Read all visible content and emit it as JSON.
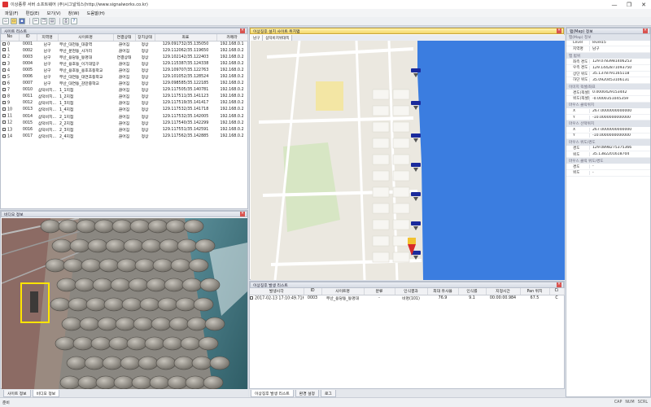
{
  "window": {
    "title": "이상종류 서버 소프트웨어 (주)시그널웍스(http://www.signalworks.co.kr)",
    "controls": [
      "—",
      "❐",
      "✕"
    ]
  },
  "menu": [
    "파일(F)",
    "편집(E)",
    "보기(V)",
    "창(W)",
    "도움말(H)"
  ],
  "toolbar_icons": [
    "new-file-icon",
    "open-folder-icon",
    "save-icon",
    "cut-icon",
    "copy-icon",
    "paste-icon",
    "print-icon",
    "help-icon"
  ],
  "site_list": {
    "title": "사이트 리스트",
    "columns": [
      "No",
      "ID",
      "지역명",
      "사이트명",
      "연결상태",
      "장치상태",
      "좌표",
      "카메라"
    ],
    "rows": [
      [
        "0",
        "0001",
        "남구",
        "부산_대천동_대광역",
        "끊어짐",
        "정상",
        "129.091732/35.135050",
        "192.168.0.1"
      ],
      [
        "1",
        "0002",
        "남구",
        "부산_문현동_사거리",
        "끊어짐",
        "정상",
        "129.112062/35.119650",
        "192.168.0.2"
      ],
      [
        "2",
        "0003",
        "남구",
        "부산_용당동_동명대",
        "연결상태",
        "정상",
        "129.102142/35.122403",
        "192.168.0.2"
      ],
      [
        "3",
        "0004",
        "남구",
        "부산_용호동_이기대입구",
        "끊어짐",
        "정상",
        "129.115387/35.124338",
        "192.168.0.2"
      ],
      [
        "4",
        "0005",
        "남구",
        "부산_용호동_용호초등학교",
        "끊어짐",
        "정상",
        "129.109707/35.122763",
        "192.168.0.2"
      ],
      [
        "5",
        "0006",
        "남구",
        "부산_대연동_대연초등학교",
        "끊어짐",
        "정상",
        "129.101052/35.128524",
        "192.168.0.2"
      ],
      [
        "6",
        "0007",
        "남구",
        "부산_대연동_감만중학교",
        "끊어짐",
        "정상",
        "129.098585/35.122185",
        "192.168.0.2"
      ],
      [
        "7",
        "0010",
        "삼덕비치...",
        "1_1지점",
        "끊어짐",
        "정상",
        "129.117505/35.140781",
        "192.168.0.2"
      ],
      [
        "8",
        "0011",
        "삼덕비치...",
        "1_2지점",
        "끊어짐",
        "정상",
        "129.117511/35.141123",
        "192.168.0.2"
      ],
      [
        "9",
        "0012",
        "삼덕비치...",
        "1_3지점",
        "끊어짐",
        "정상",
        "129.117519/35.141417",
        "192.168.0.2"
      ],
      [
        "10",
        "0013",
        "삼덕비치...",
        "1_4지점",
        "끊어짐",
        "정상",
        "129.117532/35.141718",
        "192.168.0.2"
      ],
      [
        "11",
        "0014",
        "삼덕비치...",
        "2_1지점",
        "끊어짐",
        "정상",
        "129.117532/35.142005",
        "192.168.0.2"
      ],
      [
        "12",
        "0015",
        "삼덕비치...",
        "2_2지점",
        "끊어짐",
        "정상",
        "129.117540/35.142299",
        "192.168.0.2"
      ],
      [
        "13",
        "0016",
        "삼덕비치...",
        "2_3지점",
        "끊어짐",
        "정상",
        "129.117551/35.142591",
        "192.168.0.2"
      ],
      [
        "14",
        "0017",
        "삼덕비치...",
        "2_4지점",
        "끊어짐",
        "정상",
        "129.117562/35.142885",
        "192.168.0.2"
      ]
    ]
  },
  "video_panel": {
    "title": "비디오 정보"
  },
  "left_tabs": [
    "사이트 정보",
    "비디오 정보"
  ],
  "map_panel": {
    "title": "이상징후 설치 사이트 위치맵",
    "tabs": [
      "남구",
      "삼덕비치위대쪽"
    ]
  },
  "info_panel": {
    "title": "맵(Map) 정보",
    "groups": [
      {
        "name": "맵(Map) 정보",
        "rows": [
          [
            "Level",
            "level15"
          ],
          [
            "지역명",
            "남구"
          ]
        ]
      },
      {
        "name": "맵 범위",
        "rows": [
          [
            "좌측 경도",
            "129.0783981406253"
          ],
          [
            "우측 경도",
            "129.1442871093750"
          ],
          [
            "상단 위도",
            "35.1378791165118"
          ],
          [
            "하단 위도",
            "35.0920453106131"
          ]
        ]
      },
      {
        "name": "이미지 픽셀/좌표",
        "rows": [
          [
            "경도(픽셀당)",
            "0.0000429153442"
          ],
          [
            "위도(픽셀당)",
            "-0.0000351045359"
          ]
        ]
      },
      {
        "name": "마우스 클릭위치",
        "rows": [
          [
            "X",
            "267.0000000000000"
          ],
          [
            "Y",
            "-10.0000000000000"
          ]
        ]
      },
      {
        "name": "마우스 선택위치",
        "rows": [
          [
            "X",
            "267.0000000000000"
          ],
          [
            "Y",
            "-10.0000000000000"
          ]
        ]
      },
      {
        "name": "마우스 위도/경도",
        "rows": [
          [
            "경도",
            "129.0898275375366"
          ],
          [
            "위도",
            "35.1382201618704"
          ]
        ]
      },
      {
        "name": "마우스 클릭 위도/경도",
        "rows": [
          [
            "경도",
            "-"
          ],
          [
            "위도",
            "-"
          ]
        ]
      }
    ]
  },
  "event_panel": {
    "title": "이상징후 발생 리스트",
    "columns": [
      "발생시각",
      "ID",
      "사이트명",
      "분류",
      "인식결과",
      "최대 유사율",
      "인식률",
      "지정시간",
      "Pan 위치",
      "Ci"
    ],
    "rows": [
      [
        "2017-02-13 17:10:49.716",
        "0003",
        "부산_용당동_동명대",
        "-",
        "비명(101)",
        "76.9",
        "9.1",
        "00:00:00.984",
        "67.5",
        "C"
      ]
    ]
  },
  "bottom_tabs": [
    "이상징후 발생 리스트",
    "환경 설정",
    "로그"
  ],
  "status": {
    "left": "준비",
    "indicators": [
      "CAP",
      "NUM",
      "SCRL"
    ]
  },
  "colors": {
    "accent": "#f3d76a",
    "close": "#d9534f",
    "marker": "#1a2a9c",
    "sea": "#3b7de0",
    "detect_box": "#ffe400"
  }
}
